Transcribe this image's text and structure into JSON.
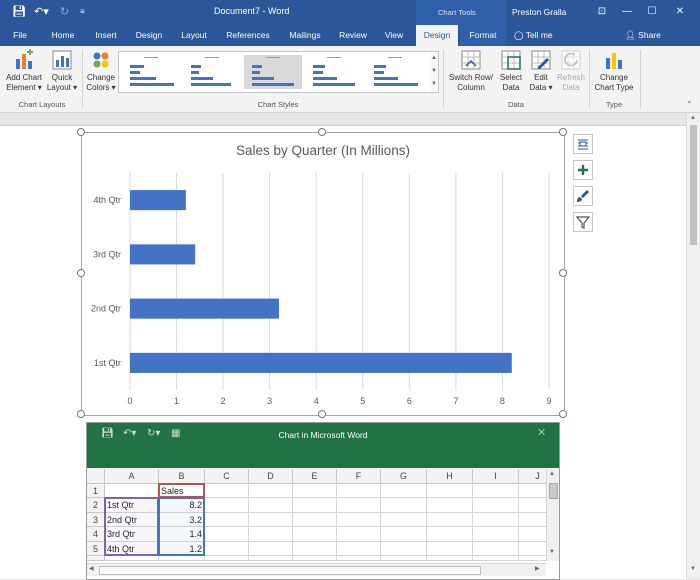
{
  "window": {
    "title": "Document7 - Word",
    "context_tab_group": "Chart Tools",
    "user": "Preston Gralla",
    "controls": {
      "restore": "⊡",
      "minimize": "—",
      "maximize": "☐",
      "close": "✕"
    }
  },
  "tabs": [
    "File",
    "Home",
    "Insert",
    "Design",
    "Layout",
    "References",
    "Mailings",
    "Review",
    "View",
    "Design",
    "Format"
  ],
  "active_tab_index": 9,
  "tell_me": "Tell me",
  "share": "Share",
  "ribbon": {
    "chart_layouts": {
      "add_chart_element": "Add Chart\nElement ▾",
      "quick_layout": "Quick\nLayout ▾",
      "label": "Chart Layouts"
    },
    "change_colors": "Change\nColors ▾",
    "chart_styles_label": "Chart Styles",
    "data": {
      "switch_row_column": "Switch Row/\nColumn",
      "select_data": "Select\nData",
      "edit_data": "Edit\nData ▾",
      "refresh_data": "Refresh\nData",
      "label": "Data"
    },
    "type": {
      "change_chart_type": "Change\nChart Type",
      "label": "Type"
    }
  },
  "chart_data": {
    "type": "bar",
    "orientation": "horizontal",
    "title": "Sales by Quarter (In Millions)",
    "categories": [
      "1st Qtr",
      "2nd Qtr",
      "3rd Qtr",
      "4th Qtr"
    ],
    "series": [
      {
        "name": "Sales",
        "values": [
          8.2,
          3.2,
          1.4,
          1.2
        ]
      }
    ],
    "xlabel": "",
    "ylabel": "",
    "xlim": [
      0,
      9
    ],
    "x_ticks": [
      0,
      1,
      2,
      3,
      4,
      5,
      6,
      7,
      8,
      9
    ],
    "grid": "vertical",
    "legend": "none",
    "color": "#4472c4"
  },
  "excel": {
    "title": "Chart in Microsoft Word",
    "columns": [
      "A",
      "B",
      "C",
      "D",
      "E",
      "F",
      "G",
      "H",
      "I",
      "J"
    ],
    "rows": [
      {
        "num": "1",
        "a": "",
        "b": "Sales"
      },
      {
        "num": "2",
        "a": "1st Qtr",
        "b": "8.2"
      },
      {
        "num": "3",
        "a": "2nd Qtr",
        "b": "3.2"
      },
      {
        "num": "4",
        "a": "3rd Qtr",
        "b": "1.4"
      },
      {
        "num": "5",
        "a": "4th Qtr",
        "b": "1.2"
      }
    ]
  },
  "colors": {
    "word_blue": "#2b579a",
    "excel_green": "#217346",
    "bar_blue": "#4472c4"
  }
}
